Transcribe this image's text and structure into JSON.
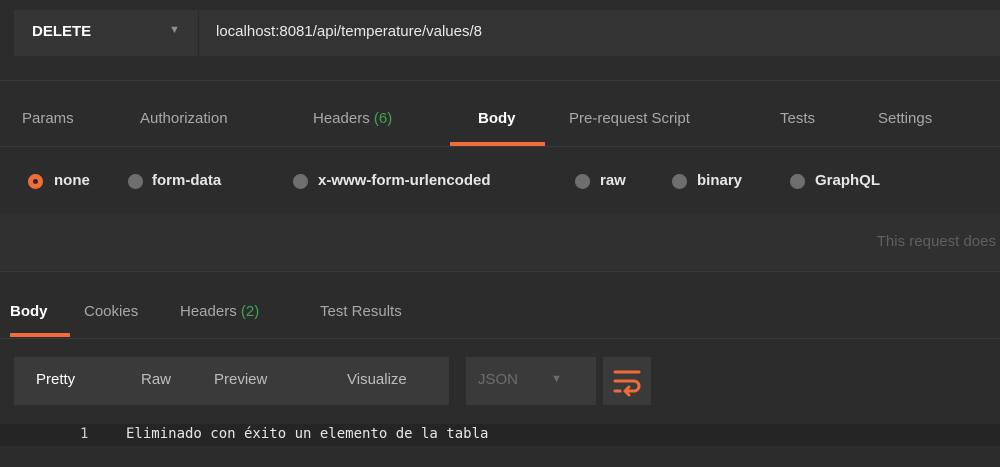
{
  "request": {
    "method": "DELETE",
    "url": "localhost:8081/api/temperature/values/8"
  },
  "request_tabs": {
    "params": "Params",
    "authorization": "Authorization",
    "headers": "Headers",
    "headers_count": "(6)",
    "body": "Body",
    "prerequest": "Pre-request Script",
    "tests": "Tests",
    "settings": "Settings"
  },
  "body_types": {
    "none": "none",
    "form_data": "form-data",
    "urlencoded": "x-www-form-urlencoded",
    "raw": "raw",
    "binary": "binary",
    "graphql": "GraphQL",
    "selected": "none"
  },
  "notice": "This request does",
  "response_tabs": {
    "body": "Body",
    "cookies": "Cookies",
    "headers": "Headers",
    "headers_count": "(2)",
    "test_results": "Test Results"
  },
  "view": {
    "pretty": "Pretty",
    "raw": "Raw",
    "preview": "Preview",
    "visualize": "Visualize",
    "format": "JSON"
  },
  "response_body": {
    "line_number": "1",
    "text": "Eliminado con éxito un elemento de la tabla"
  },
  "colors": {
    "accent": "#f26b3a",
    "count_green": "#3fa54b"
  }
}
